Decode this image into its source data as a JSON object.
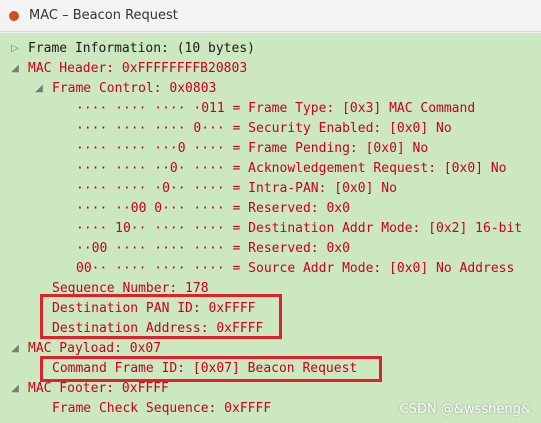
{
  "window": {
    "title": "MAC – Beacon Request"
  },
  "icons": {
    "collapsed": "▷",
    "expanded": "◢"
  },
  "colors": {
    "tree_bg": "#cbe8c0",
    "field_text": "#c8001a",
    "highlight": "#e0202a"
  },
  "tree": {
    "frame_info": "Frame Information: (10 bytes)",
    "mac_header": "MAC Header: 0xFFFFFFFFB20803",
    "frame_control": "Frame Control: 0x0803",
    "fc_bits": [
      "···· ···· ···· ·011 = Frame Type: [0x3] MAC Command",
      "···· ···· ···· 0··· = Security Enabled: [0x0] No",
      "···· ···· ···0 ···· = Frame Pending: [0x0] No",
      "···· ···· ··0· ···· = Acknowledgement Request: [0x0] No",
      "···· ···· ·0·· ···· = Intra-PAN: [0x0] No",
      "···· ··00 0··· ···· = Reserved: 0x0",
      "···· 10·· ···· ···· = Destination Addr Mode: [0x2] 16-bit",
      "··00 ···· ···· ···· = Reserved: 0x0",
      "00·· ···· ···· ···· = Source Addr Mode: [0x0] No Address"
    ],
    "sequence_number": "Sequence Number: 178",
    "dest_pan_id": "Destination PAN ID: 0xFFFF",
    "dest_address": "Destination Address: 0xFFFF",
    "mac_payload": "MAC Payload: 0x07",
    "command_frame_id": "Command Frame ID: [0x07] Beacon Request",
    "mac_footer": "MAC Footer: 0xFFFF",
    "fcs": "Frame Check Sequence: 0xFFFF"
  },
  "watermark": "CSDN @&wssheng&"
}
